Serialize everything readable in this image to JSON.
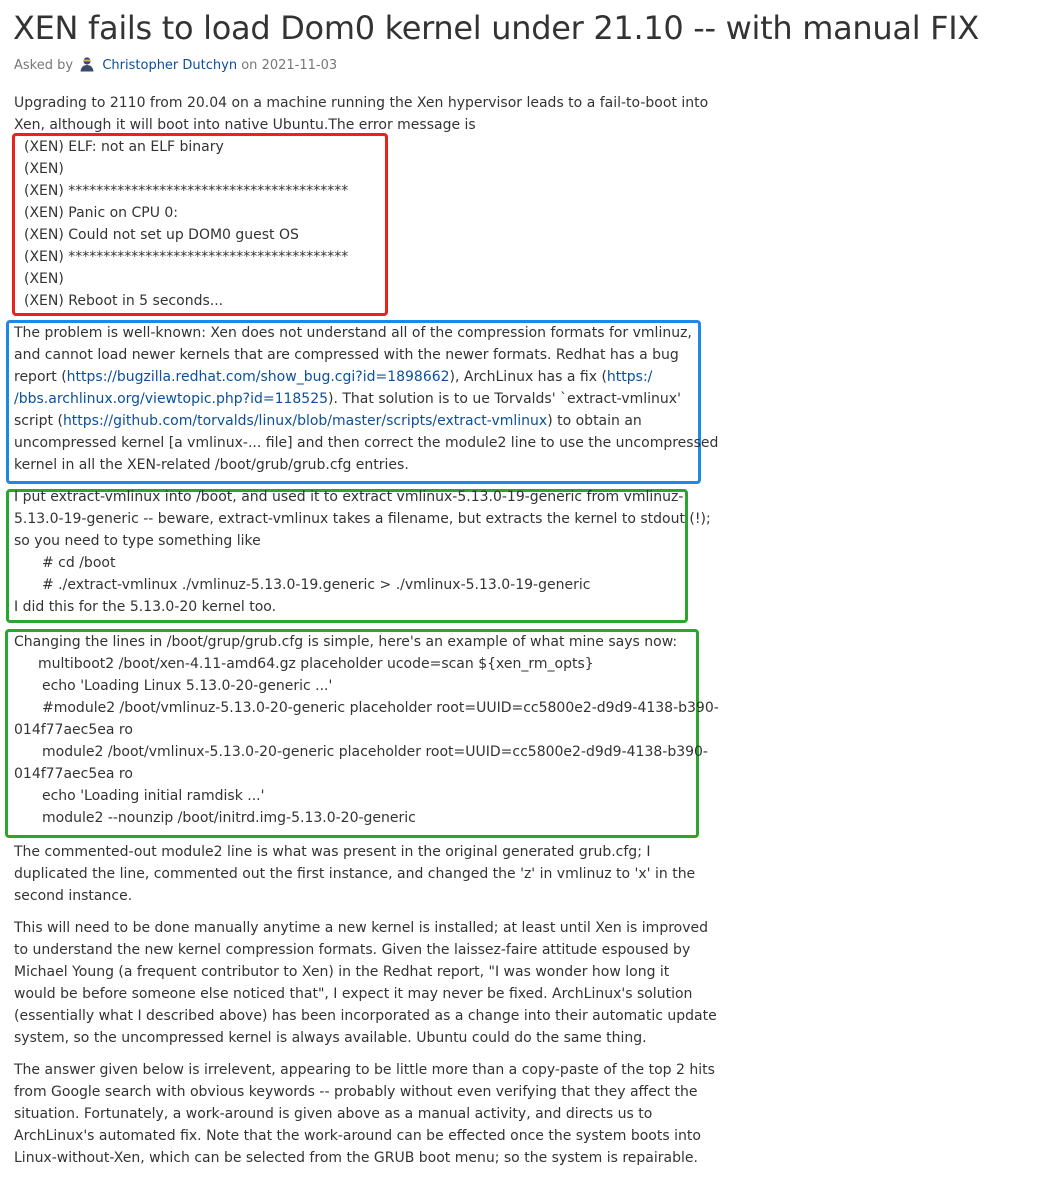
{
  "question": {
    "title": "XEN fails to load Dom0 kernel under 21.10 -- with manual FIX",
    "asked_by_label": "Asked by",
    "author": "Christopher Dutchyn",
    "date_prefix": "on",
    "date": "2021-11-03"
  },
  "intro": {
    "line1": "Upgrading to 2110 from 20.04 on a machine running the Xen hypervisor leads to a fail-to-boot into",
    "line2": "Xen, although it will boot into native Ubuntu.The error message is"
  },
  "error_log": [
    "(XEN) ELF: not an ELF binary",
    "(XEN)",
    "(XEN) ****************************************",
    "(XEN) Panic on CPU 0:",
    "(XEN) Could not set up DOM0 guest OS",
    "(XEN) ****************************************",
    "(XEN)",
    "(XEN) Reboot in 5 seconds..."
  ],
  "problem": {
    "l1": "The problem is well-known: Xen does not understand all of the compression formats for vmlinuz,",
    "l2": "and cannot load newer kernels that are compressed with the newer formats. Redhat has a bug",
    "l3a": "report (",
    "link_bugzilla": "https://bugzilla.redhat.com/show_bug.cgi?id=1898662",
    "l3b": "), ArchLinux has a fix (",
    "link_arch_part1": "https:/",
    "link_arch_part2": "/bbs.archlinux.org/viewtopic.php?id=118525",
    "l4b": "). That solution is to ue Torvalds' `extract-vmlinux'",
    "l5a": "script (",
    "link_github": "https://github.com/torvalds/linux/blob/master/scripts/extract-vmlinux",
    "l5b": ") to obtain an",
    "l6": "uncompressed kernel [a vmlinux-... file] and then correct the module2 line to use the uncompressed",
    "l7": "kernel in all the XEN-related /boot/grub/grub.cfg entries."
  },
  "extract": {
    "l1": "I put extract-vmlinux into /boot, and used it to extract vmlinux-5.13.0-19-generic from vmlinuz-",
    "l2": "5.13.0-19-generic -- beware, extract-vmlinux takes a filename, but extracts the kernel to stdout (!);",
    "l3": "so you need to type something like",
    "cmd1": "# cd /boot",
    "cmd2": "# ./extract-vmlinux ./vmlinuz-5.13.0-19.generic > ./vmlinux-5.13.0-19-generic",
    "l4": "I did this for the 5.13.0-20 kernel too."
  },
  "grub": {
    "intro": "Changing the lines in /boot/grup/grub.cfg is simple, here's an example of what mine says now:",
    "g1": "multiboot2 /boot/xen-4.11-amd64.gz placeholder ucode=scan ${xen_rm_opts}",
    "g2": "echo 'Loading Linux 5.13.0-20-generic ...'",
    "g3a": "#module2 /boot/vmlinuz-5.13.0-20-generic placeholder root=UUID=cc5800e2-d9d9-4138-b390-",
    "g3b": "014f77aec5ea ro",
    "g4a": "module2 /boot/vmlinux-5.13.0-20-generic placeholder root=UUID=cc5800e2-d9d9-4138-b390-",
    "g4b": "014f77aec5ea ro",
    "g5": "echo 'Loading initial ramdisk ...'",
    "g6": "module2 --nounzip /boot/initrd.img-5.13.0-20-generic"
  },
  "commented": {
    "l1": "The commented-out module2 line is what was present in the original generated grub.cfg; I",
    "l2": "duplicated the line, commented out the first instance, and changed the 'z' in vmlinuz to 'x' in the",
    "l3": "second instance."
  },
  "manual": {
    "l1": "This will need to be done manually anytime a new kernel is installed; at least until Xen is improved",
    "l2": "to understand the new kernel compression formats. Given the laissez-faire attitude espoused by",
    "l3": "Michael Young (a frequent contributor to Xen) in the Redhat report, \"I was wonder how long it",
    "l4": "would be before someone else noticed that\", I expect it may never be fixed. ArchLinux's solution",
    "l5": "(essentially what I described above) has been incorporated as a change into their automatic update",
    "l6": "system, so the uncompressed kernel is always available. Ubuntu could do the same thing."
  },
  "answer_note": {
    "l1": "The answer given below is irrelevent, appearing to be little more than a copy-paste of the top 2 hits",
    "l2": "from Google search with obvious keywords -- probably without even verifying that they affect the",
    "l3": "situation. Fortunately, a work-around is given above as a manual activity, and directs us to",
    "l4": "ArchLinux's automated fix. Note that the work-around can be effected once the system boots into",
    "l5": "Linux-without-Xen, which can be selected from the GRUB boot menu; so the system is repairable."
  },
  "colors": {
    "link": "#0a4f9c",
    "box_red": "#e8231c",
    "box_blue": "#1e88e5",
    "box_green": "#2aa52e"
  }
}
